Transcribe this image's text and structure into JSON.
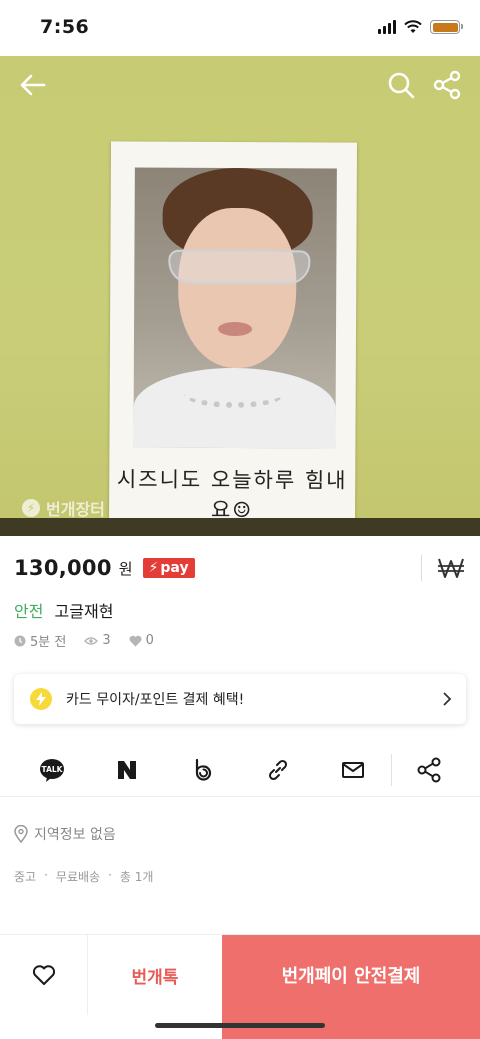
{
  "status_bar": {
    "time": "7:56"
  },
  "photo": {
    "caption": "시즈니도 오늘하루 힘내요☺",
    "watermark": "번개장터"
  },
  "product": {
    "price": "130,000",
    "currency": "원",
    "pay_badge": "pay",
    "safe_tag": "안전",
    "title": "고글재현",
    "time_ago": "5분 전",
    "views": "3",
    "likes": "0"
  },
  "benefit": {
    "text": "카드 무이자/포인트 결제 혜택!"
  },
  "share_icons": [
    "kakaotalk-icon",
    "naver-icon",
    "band-icon",
    "link-icon",
    "mail-icon",
    "share-icon"
  ],
  "location": {
    "text": "지역정보 없음"
  },
  "tags": [
    "중고",
    "무료배송",
    "총 1개"
  ],
  "bottom": {
    "talk_label": "번개톡",
    "pay_label": "번개페이 안전결제"
  },
  "colors": {
    "accent": "#ee6f6b",
    "safe": "#3cae5c",
    "pay_badge": "#e43c36"
  }
}
